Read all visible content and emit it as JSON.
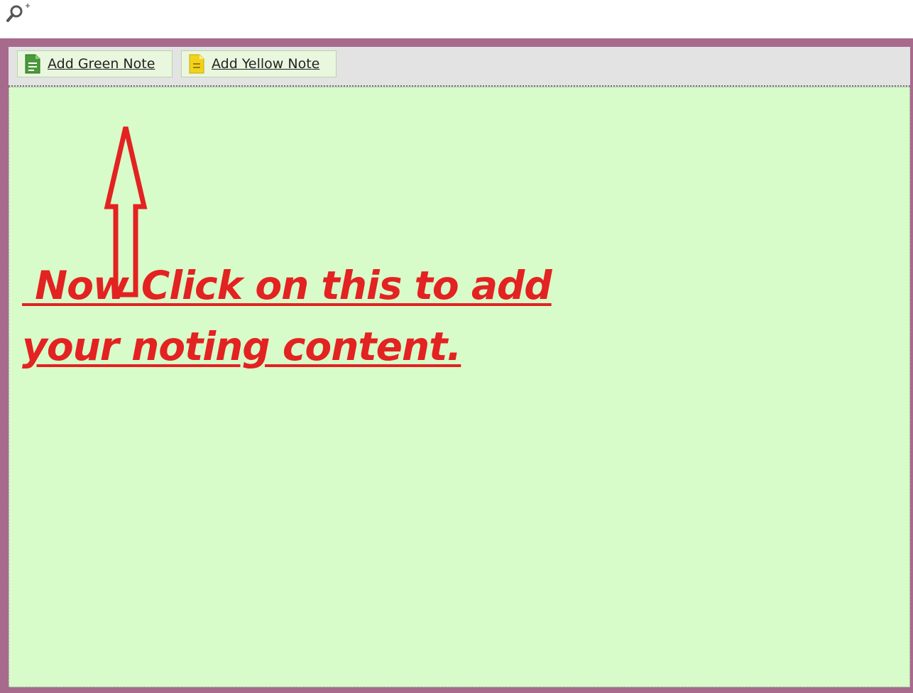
{
  "toolbar": {
    "buttons": [
      {
        "label": "Add Green Note",
        "icon": "green-note-icon",
        "color": "#4a9a3a"
      },
      {
        "label": "Add Yellow Note",
        "icon": "yellow-note-icon",
        "color": "#f2d21b"
      }
    ]
  },
  "annotation": {
    "lines": [
      " Now Click on this to add",
      "your noting content."
    ],
    "color": "#e32222",
    "pointer": "up-arrow-icon"
  },
  "colors": {
    "frame": "#a76a8d",
    "toolbar": "#e3e3e3",
    "note_area": "#d7fcc9"
  }
}
